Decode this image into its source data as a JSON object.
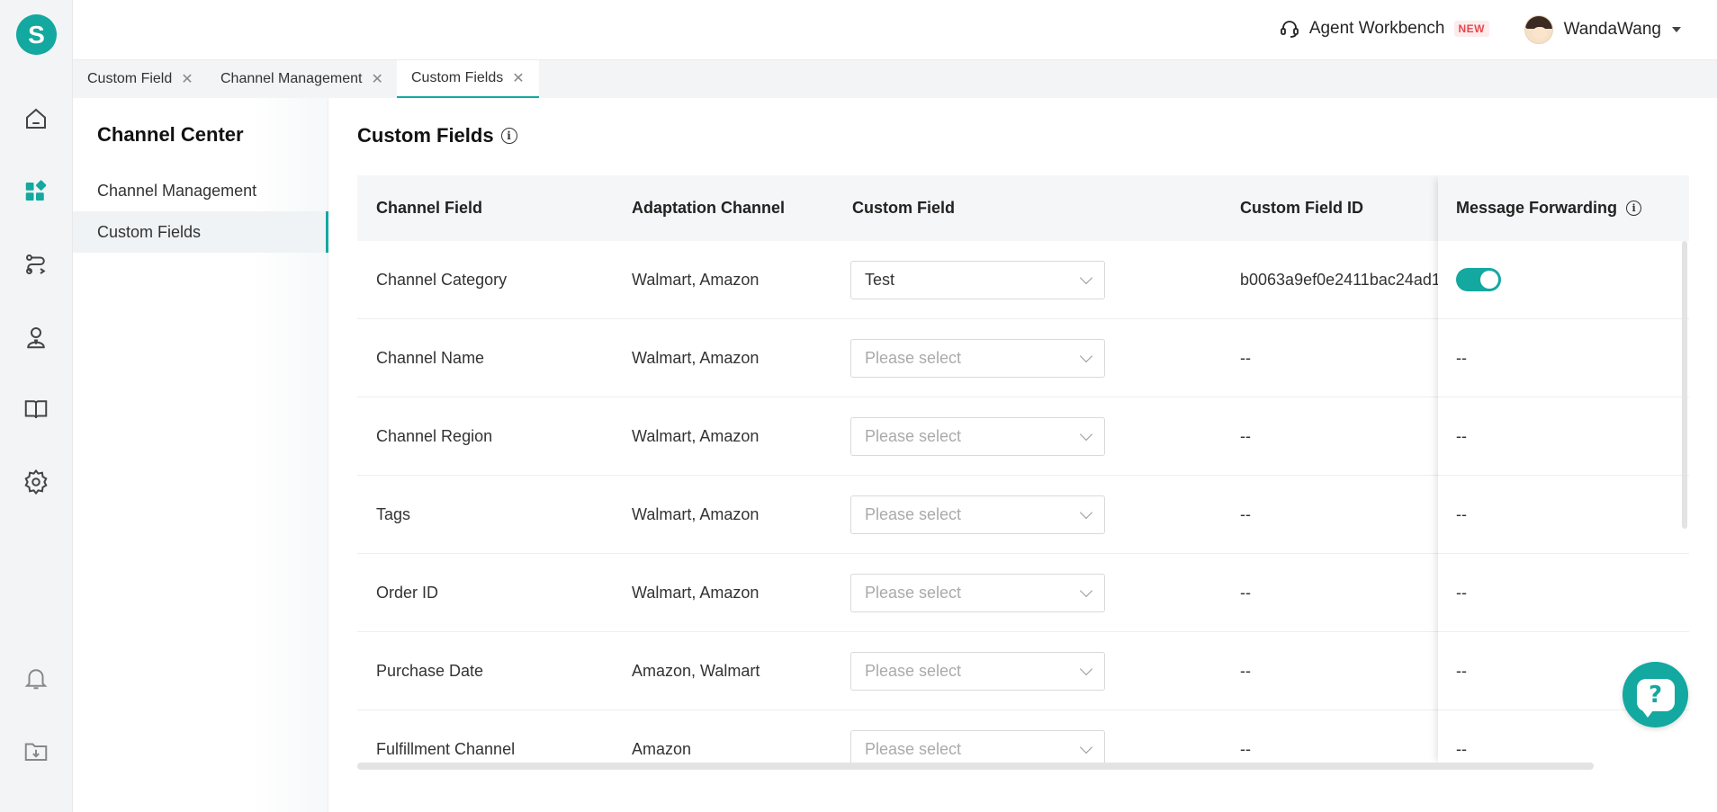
{
  "app": {
    "logo_letter": "S"
  },
  "rail": {
    "icons": [
      "home-icon",
      "apps-icon",
      "routing-icon",
      "agent-icon",
      "knowledge-book-icon",
      "settings-gear-icon",
      "notification-bell-icon",
      "download-folder-icon"
    ]
  },
  "topbar": {
    "agent_workbench": "Agent Workbench",
    "new_badge": "NEW",
    "user_name": "WandaWang"
  },
  "tabs": [
    {
      "label": "Custom Field",
      "close": "✕"
    },
    {
      "label": "Channel Management",
      "close": "✕"
    },
    {
      "label": "Custom Fields",
      "close": "✕"
    }
  ],
  "subnav": {
    "title": "Channel Center",
    "items": [
      {
        "label": "Channel Management"
      },
      {
        "label": "Custom Fields"
      }
    ]
  },
  "main": {
    "title": "Custom Fields",
    "info": "i",
    "table": {
      "headers": [
        "Channel Field",
        "Adaptation Channel",
        "Custom Field",
        "Custom Field ID",
        "Message Forwarding"
      ],
      "rows": [
        {
          "channel_field": "Channel Category",
          "adaptation": "Walmart, Amazon",
          "custom_field": "Test",
          "custom_field_id": "b0063a9ef0e2411bac24ad1",
          "forwarding": "on"
        },
        {
          "channel_field": "Channel Name",
          "adaptation": "Walmart, Amazon",
          "custom_field": "",
          "custom_field_id": "--",
          "forwarding": "--"
        },
        {
          "channel_field": "Channel Region",
          "adaptation": "Walmart, Amazon",
          "custom_field": "",
          "custom_field_id": "--",
          "forwarding": "--"
        },
        {
          "channel_field": "Tags",
          "adaptation": "Walmart, Amazon",
          "custom_field": "",
          "custom_field_id": "--",
          "forwarding": "--"
        },
        {
          "channel_field": "Order ID",
          "adaptation": "Walmart, Amazon",
          "custom_field": "",
          "custom_field_id": "--",
          "forwarding": "--"
        },
        {
          "channel_field": "Purchase Date",
          "adaptation": "Amazon, Walmart",
          "custom_field": "",
          "custom_field_id": "--",
          "forwarding": "--"
        },
        {
          "channel_field": "Fulfillment Channel",
          "adaptation": "Amazon",
          "custom_field": "",
          "custom_field_id": "--",
          "forwarding": "--"
        }
      ],
      "select_placeholder": "Please select"
    }
  },
  "help": {
    "symbol": "?"
  },
  "colors": {
    "accent": "#13a8a0"
  }
}
